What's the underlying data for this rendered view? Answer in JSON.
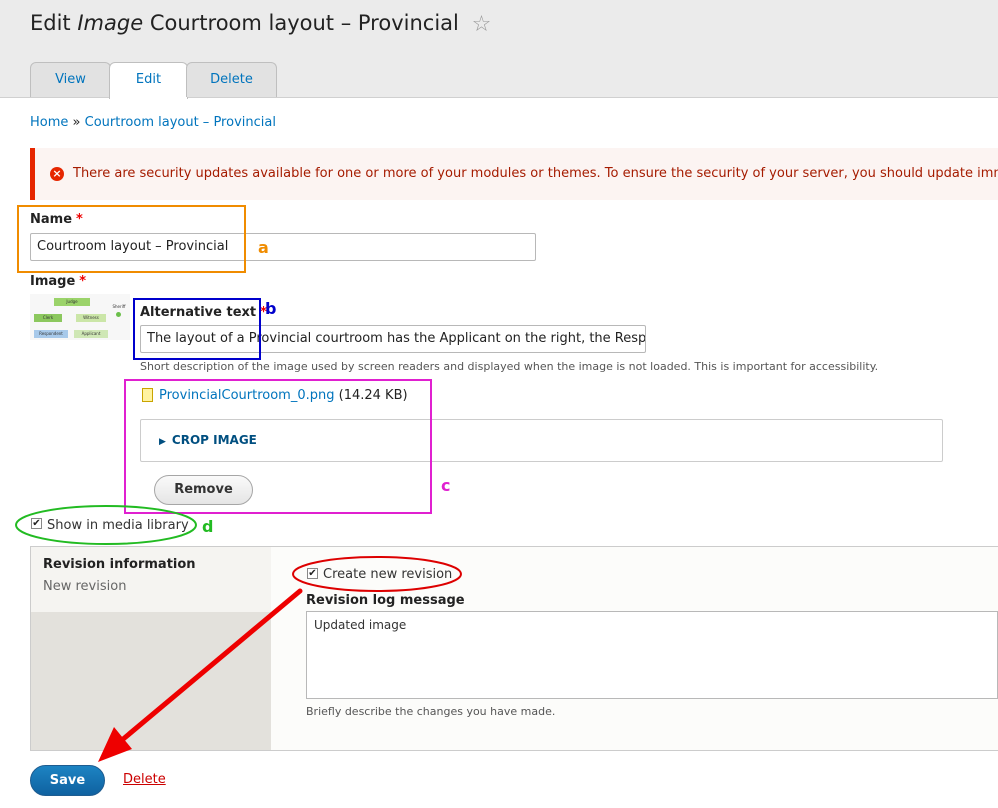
{
  "page": {
    "title_prefix": "Edit",
    "title_type": "Image",
    "title_name": "Courtroom layout – Provincial",
    "star_icon": "star-outline-icon"
  },
  "tabs": [
    {
      "label": "View",
      "active": false
    },
    {
      "label": "Edit",
      "active": true
    },
    {
      "label": "Delete",
      "active": false
    }
  ],
  "breadcrumb": {
    "home": "Home",
    "separator": "»",
    "current": "Courtroom layout – Provincial"
  },
  "alert": {
    "icon": "error-circle-icon",
    "text": "There are security updates available for one or more of your modules or themes. To ensure the security of your server, you should update immedia"
  },
  "form": {
    "name_label": "Name",
    "name_value": "Courtroom layout – Provincial",
    "image_label": "Image",
    "required_mark": "*",
    "thumbnail_labels": {
      "judge": "Judge",
      "sheriff": "Sheriff",
      "clerk": "Clerk",
      "witness": "Witness",
      "respondent": "Respondent",
      "applicant": "Applicant"
    },
    "alt_label": "Alternative text",
    "alt_value": "The layout of a Provincial courtroom has the Applicant on the right, the Respo",
    "alt_description": "Short description of the image used by screen readers and displayed when the image is not loaded. This is important for accessibility.",
    "file_name": "ProvincialCourtroom_0.png",
    "file_size": "(14.24 KB)",
    "crop_label": "CROP IMAGE",
    "remove_label": "Remove",
    "media_library_label": "Show in media library",
    "media_library_checked": true
  },
  "revision": {
    "title": "Revision information",
    "summary": "New revision",
    "create_label": "Create new revision",
    "create_checked": true,
    "log_label": "Revision log message",
    "log_value": "Updated image",
    "log_description": "Briefly describe the changes you have made."
  },
  "actions": {
    "save_label": "Save",
    "delete_label": "Delete"
  },
  "annotations": {
    "a": "a",
    "b": "b",
    "c": "c",
    "d": "d",
    "colors": {
      "a": "#f08c00",
      "b": "#0000cc",
      "c": "#e020d0",
      "d": "#22bb22",
      "e": "#dd0000"
    }
  },
  "colors": {
    "link": "#0074bd",
    "error": "#e62600",
    "primary_button": "#1474b5"
  }
}
